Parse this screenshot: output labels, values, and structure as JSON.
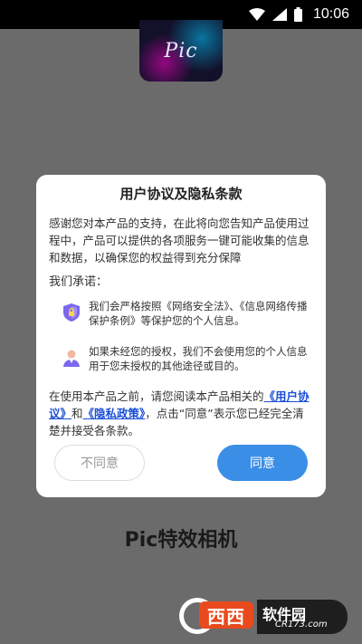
{
  "status_bar": {
    "time": "10:06"
  },
  "app_icon": {
    "logo_text": "Pic"
  },
  "dialog": {
    "title": "用户协议及隐私条款",
    "intro": "感谢您对本产品的支持，在此将向您告知产品使用过程中，产品可以提供的各项服务一键可能收集的信息和数据，以确保您的权益得到充分保障",
    "promise_heading": "我们承诺：",
    "promises": [
      {
        "icon": "shield-lock-icon",
        "text": "我们会严格按照《网络安全法》、《信息网络传播保护条例》等保护您的个人信息。"
      },
      {
        "icon": "user-icon",
        "text": "如果未经您的授权，我们不会使用您的个人信息用于您未授权的其他途径或目的。"
      }
    ],
    "notice_prefix": "在使用本产品之前，请您阅读本产品相关的",
    "link_agreement": "《用户协议》",
    "notice_and": "和",
    "link_privacy": "《隐私政策》",
    "notice_suffix": "，点击“同意”表示您已经完全清楚并接受各条款。",
    "disagree_label": "不同意",
    "agree_label": "同意"
  },
  "app_name": "Pic特效相机",
  "watermark": {
    "name": "软件园",
    "url": "CR173.com",
    "box_text": "西西"
  },
  "colors": {
    "accent": "#3a8ee6",
    "link": "#1a4fd6",
    "overlay": "#6b6b6b"
  }
}
